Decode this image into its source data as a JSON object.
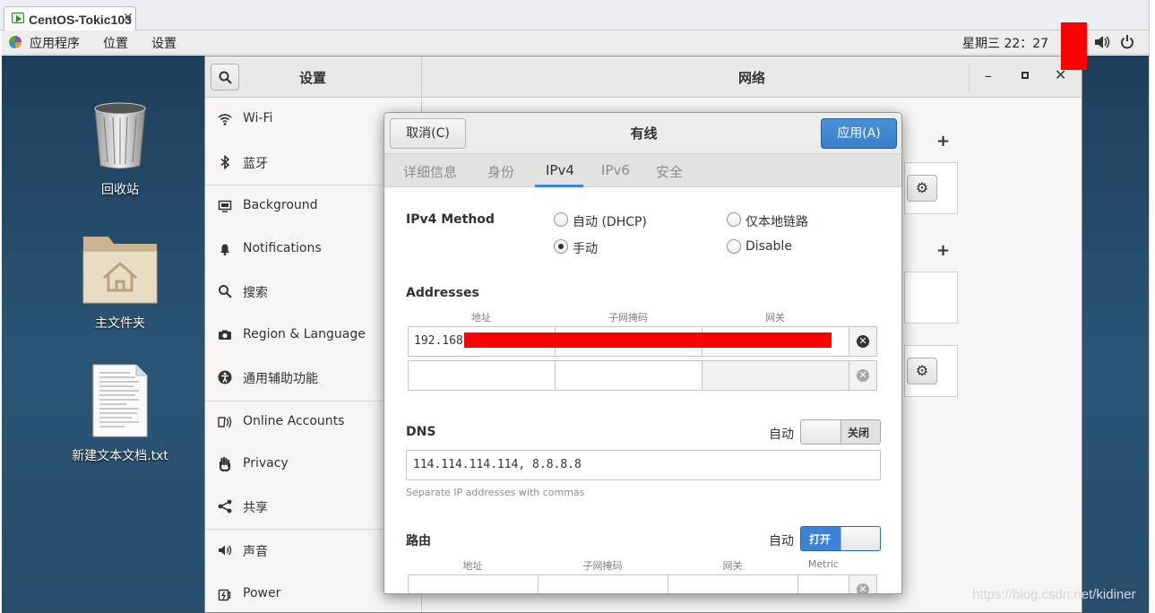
{
  "vm_tab": {
    "title": "CentOS-Tokic103",
    "close": "✕"
  },
  "topbar": {
    "applications": "应用程序",
    "places": "位置",
    "settings": "设置",
    "clock": "星期三 22：27"
  },
  "desktop_icons": [
    {
      "label": "回收站"
    },
    {
      "label": "主文件夹"
    },
    {
      "label": "新建文本文档.txt"
    }
  ],
  "settings": {
    "sidebar_title": "设置",
    "panel_title": "网络",
    "sidebar_items": [
      {
        "label": "Wi-Fi",
        "icon": "wifi-icon"
      },
      {
        "label": "蓝牙",
        "icon": "bluetooth-icon"
      },
      {
        "label": "Background",
        "icon": "background-icon"
      },
      {
        "label": "Notifications",
        "icon": "bell-icon"
      },
      {
        "label": "搜索",
        "icon": "search-icon"
      },
      {
        "label": "Region & Language",
        "icon": "camera-icon"
      },
      {
        "label": "通用辅助功能",
        "icon": "accessibility-icon"
      },
      {
        "label": "Online Accounts",
        "icon": "online-accounts-icon"
      },
      {
        "label": "Privacy",
        "icon": "hand-icon"
      },
      {
        "label": "共享",
        "icon": "share-icon"
      },
      {
        "label": "声音",
        "icon": "speaker-icon"
      },
      {
        "label": "Power",
        "icon": "power-icon"
      }
    ],
    "add_symbol": "+"
  },
  "dialog": {
    "cancel": "取消(C)",
    "title": "有线",
    "apply": "应用(A)",
    "tabs": [
      "详细信息",
      "身份",
      "IPv4",
      "IPv6",
      "安全"
    ],
    "active_tab": "IPv4",
    "ipv4_method_label": "IPv4 Method",
    "methods": [
      {
        "label": "自动 (DHCP)",
        "checked": false
      },
      {
        "label": "仅本地链路",
        "checked": false
      },
      {
        "label": "手动",
        "checked": true
      },
      {
        "label": "Disable",
        "checked": false
      }
    ],
    "addresses_label": "Addresses",
    "addr_cols": [
      "地址",
      "子网掩码",
      "网关"
    ],
    "address_row1": "192.168",
    "dns_label": "DNS",
    "dns_auto_label": "自动",
    "dns_switch": "关闭",
    "dns_value": "114.114.114.114, 8.8.8.8",
    "dns_hint": "Separate IP addresses with commas",
    "routes_label": "路由",
    "routes_auto_label": "自动",
    "routes_switch": "打开",
    "route_cols": [
      "地址",
      "子网掩码",
      "网关",
      "Metric"
    ]
  },
  "watermark": "https://blog.csdn.net/kidiner"
}
